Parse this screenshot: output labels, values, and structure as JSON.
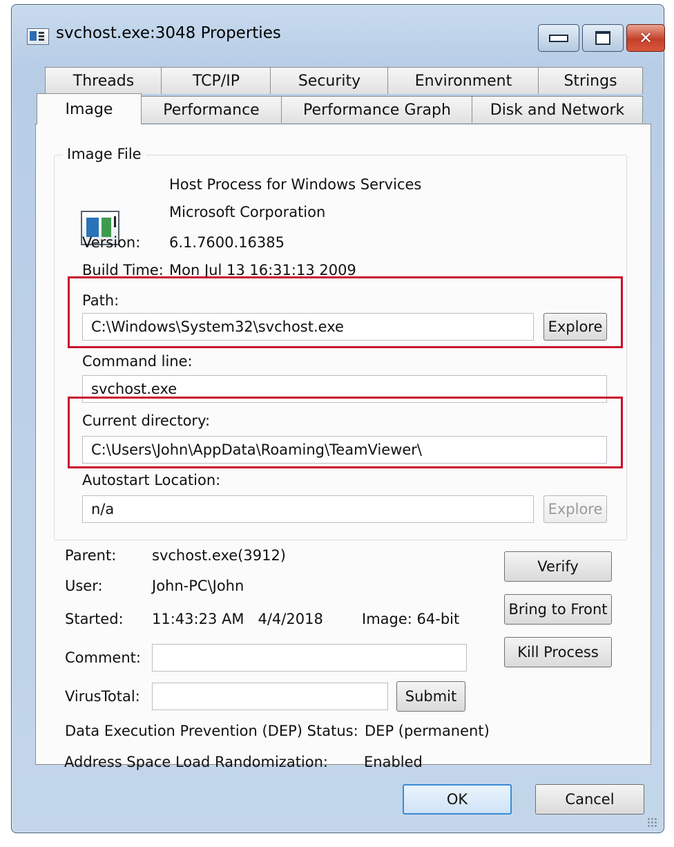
{
  "window": {
    "title": "svchost.exe:3048 Properties",
    "controls": {
      "minimize": "",
      "maximize": "",
      "close": "✕"
    }
  },
  "tabs": {
    "row1": [
      "Threads",
      "TCP/IP",
      "Security",
      "Environment",
      "Strings"
    ],
    "row2": [
      "Image",
      "Performance",
      "Performance Graph",
      "Disk and Network"
    ],
    "active": "Image"
  },
  "image_file": {
    "group_label": "Image File",
    "description": "Host Process for Windows Services",
    "company": "Microsoft Corporation",
    "version_label": "Version:",
    "version": "6.1.7600.16385",
    "build_time_label": "Build Time:",
    "build_time": "Mon Jul 13 16:31:13 2009",
    "path_label": "Path:",
    "path": "C:\\Windows\\System32\\svchost.exe",
    "explore_label": "Explore",
    "command_line_label": "Command line:",
    "command_line": "svchost.exe",
    "current_directory_label": "Current directory:",
    "current_directory": "C:\\Users\\John\\AppData\\Roaming\\TeamViewer\\",
    "autostart_label": "Autostart Location:",
    "autostart": "n/a",
    "autostart_explore_label": "Explore"
  },
  "process": {
    "parent_label": "Parent:",
    "parent": "svchost.exe(3912)",
    "user_label": "User:",
    "user": "John-PC\\John",
    "started_label": "Started:",
    "started": "11:43:23 AM   4/4/2018",
    "image_bits": "Image: 64-bit",
    "comment_label": "Comment:",
    "comment": "",
    "virustotal_label": "VirusTotal:",
    "virustotal": "",
    "submit_label": "Submit",
    "dep_label": "Data Execution Prevention (DEP) Status:",
    "dep": "DEP (permanent)",
    "aslr_label": "Address Space Load Randomization:",
    "aslr": "Enabled"
  },
  "actions": {
    "verify": "Verify",
    "bring_to_front": "Bring to Front",
    "kill_process": "Kill Process"
  },
  "footer": {
    "ok": "OK",
    "cancel": "Cancel"
  },
  "colors": {
    "highlight": "#c8102e",
    "titlebar": "#b7cde6",
    "close_button": "#c4402a"
  }
}
